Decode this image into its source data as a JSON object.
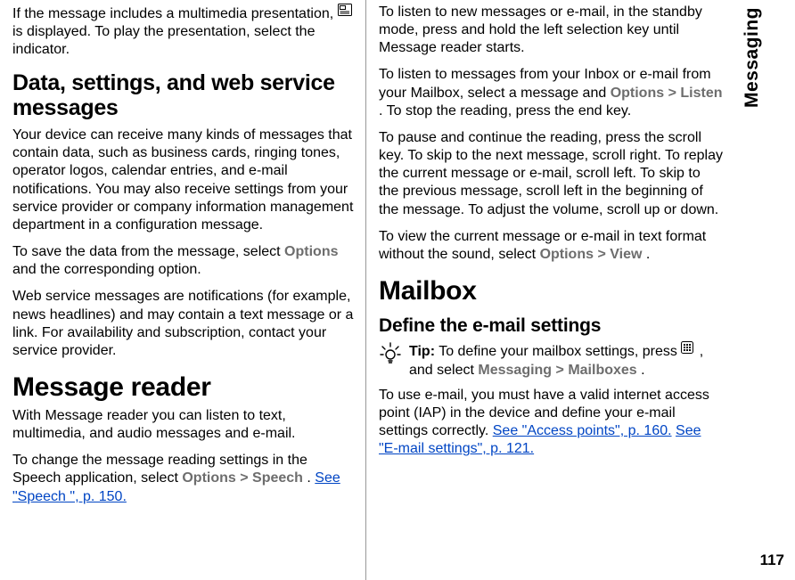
{
  "left": {
    "p1_a": "If the message includes a multimedia presentation, ",
    "p1_b": " is displayed. To play the presentation, select the indicator.",
    "h2_data": "Data, settings, and web service messages",
    "p2": "Your device can receive many kinds of messages that contain data, such as business cards, ringing tones, operator logos, calendar entries, and e-mail notifications. You may also receive settings from your service provider or company information management department in a configuration message.",
    "p3_a": "To save the data from the message, select ",
    "p3_options": "Options",
    "p3_b": " and the corresponding option.",
    "p4": "Web service messages are notifications (for example, news headlines) and may contain a text message or a link. For availability and subscription, contact your service provider.",
    "h1_reader": "Message reader",
    "p5": "With Message reader you can listen to text, multimedia, and audio messages and e-mail.",
    "p6_a": "To change the message reading settings in the Speech application, select ",
    "p6_options": "Options",
    "p6_gt1": " > ",
    "p6_speech": "Speech",
    "p6_b": ". ",
    "p6_link": "See \"Speech \", p. 150."
  },
  "right": {
    "p1": "To listen to new messages or e-mail, in the standby mode, press and hold the left selection key until Message reader starts.",
    "p2_a": "To listen to messages from your Inbox or e-mail from your Mailbox, select a message and ",
    "p2_options": "Options",
    "p2_gt": " > ",
    "p2_listen": "Listen",
    "p2_b": ". To stop the reading, press the end key.",
    "p3": "To pause and continue the reading, press the scroll key. To skip to the next message, scroll right. To replay the current message or e-mail, scroll left. To skip to the previous message, scroll left in the beginning of the message. To adjust the volume, scroll up or down.",
    "p4_a": "To view the current message or e-mail in text format without the sound, select ",
    "p4_options": "Options",
    "p4_gt": " > ",
    "p4_view": "View",
    "p4_b": ".",
    "h1_mailbox": "Mailbox",
    "h3_define": "Define the e-mail settings",
    "tip_label": "Tip:",
    "tip_a": " To define your mailbox settings, press ",
    "tip_b": ", and select ",
    "tip_messaging": "Messaging",
    "tip_gt": " > ",
    "tip_mailboxes": "Mailboxes",
    "tip_c": ".",
    "p5_a": "To use e-mail, you must have a valid internet access point (IAP) in the device and define your e-mail settings correctly. ",
    "p5_link1": "See \"Access points\", p. 160.",
    "p5_sep": " ",
    "p5_link2": "See \"E-mail settings\", p. 121."
  },
  "sidebar": {
    "section": "Messaging"
  },
  "pagenum": "117"
}
